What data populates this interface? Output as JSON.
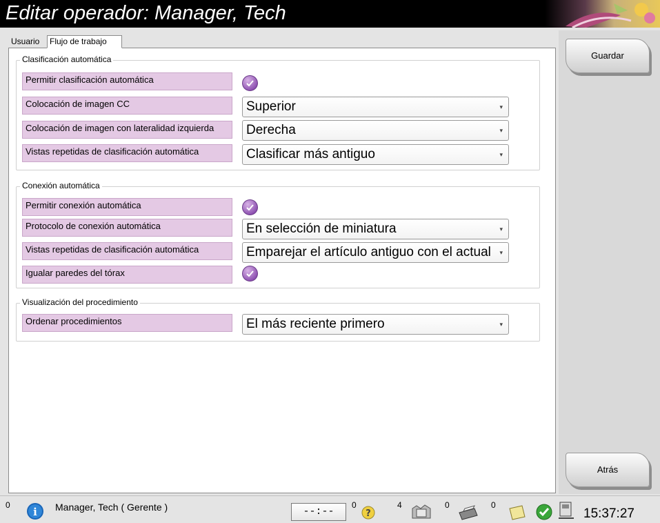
{
  "window": {
    "title": "Editar operador: Manager, Tech"
  },
  "tabs": [
    {
      "label": "Usuario",
      "active": false
    },
    {
      "label": "Flujo de trabajo",
      "active": true
    }
  ],
  "groups": {
    "auto_hanging": {
      "title": "Clasificación automática",
      "rows": [
        {
          "label": "Permitir clasificación automática",
          "type": "checkbox",
          "checked": true
        },
        {
          "label": "Colocación de imagen CC",
          "type": "select",
          "value": "Superior"
        },
        {
          "label": "Colocación de imagen con lateralidad izquierda",
          "type": "select",
          "value": "Derecha"
        },
        {
          "label": "Vistas repetidas de clasificación automática",
          "type": "select",
          "value": "Clasificar más antiguo"
        }
      ]
    },
    "auto_pairing": {
      "title": "Conexión automática",
      "rows": [
        {
          "label": "Permitir conexión automática",
          "type": "checkbox",
          "checked": true
        },
        {
          "label": "Protocolo de conexión automática",
          "type": "select",
          "value": "En selección de miniatura"
        },
        {
          "label": "Vistas repetidas de clasificación automática",
          "type": "select",
          "value": "Emparejar el artículo antiguo con el actual"
        },
        {
          "label": "Igualar paredes del tórax",
          "type": "checkbox",
          "checked": true
        }
      ]
    },
    "procedure_display": {
      "title": "Visualización del procedimiento",
      "rows": [
        {
          "label": "Ordenar procedimientos",
          "type": "select",
          "value": "El más reciente primero"
        }
      ]
    }
  },
  "buttons": {
    "save": "Guardar",
    "back": "Atrás"
  },
  "statusbar": {
    "alert_count": "0",
    "user": "Manager, Tech ( Gerente )",
    "timer": "--:--",
    "help_count": "0",
    "queue_count": "4",
    "print_count": "0",
    "output_count": "0",
    "clock": "15:37:27"
  },
  "colors": {
    "label_bg": "#e4c9e4",
    "check_purple": "#8c4fb0",
    "title_bar": "#000000"
  }
}
